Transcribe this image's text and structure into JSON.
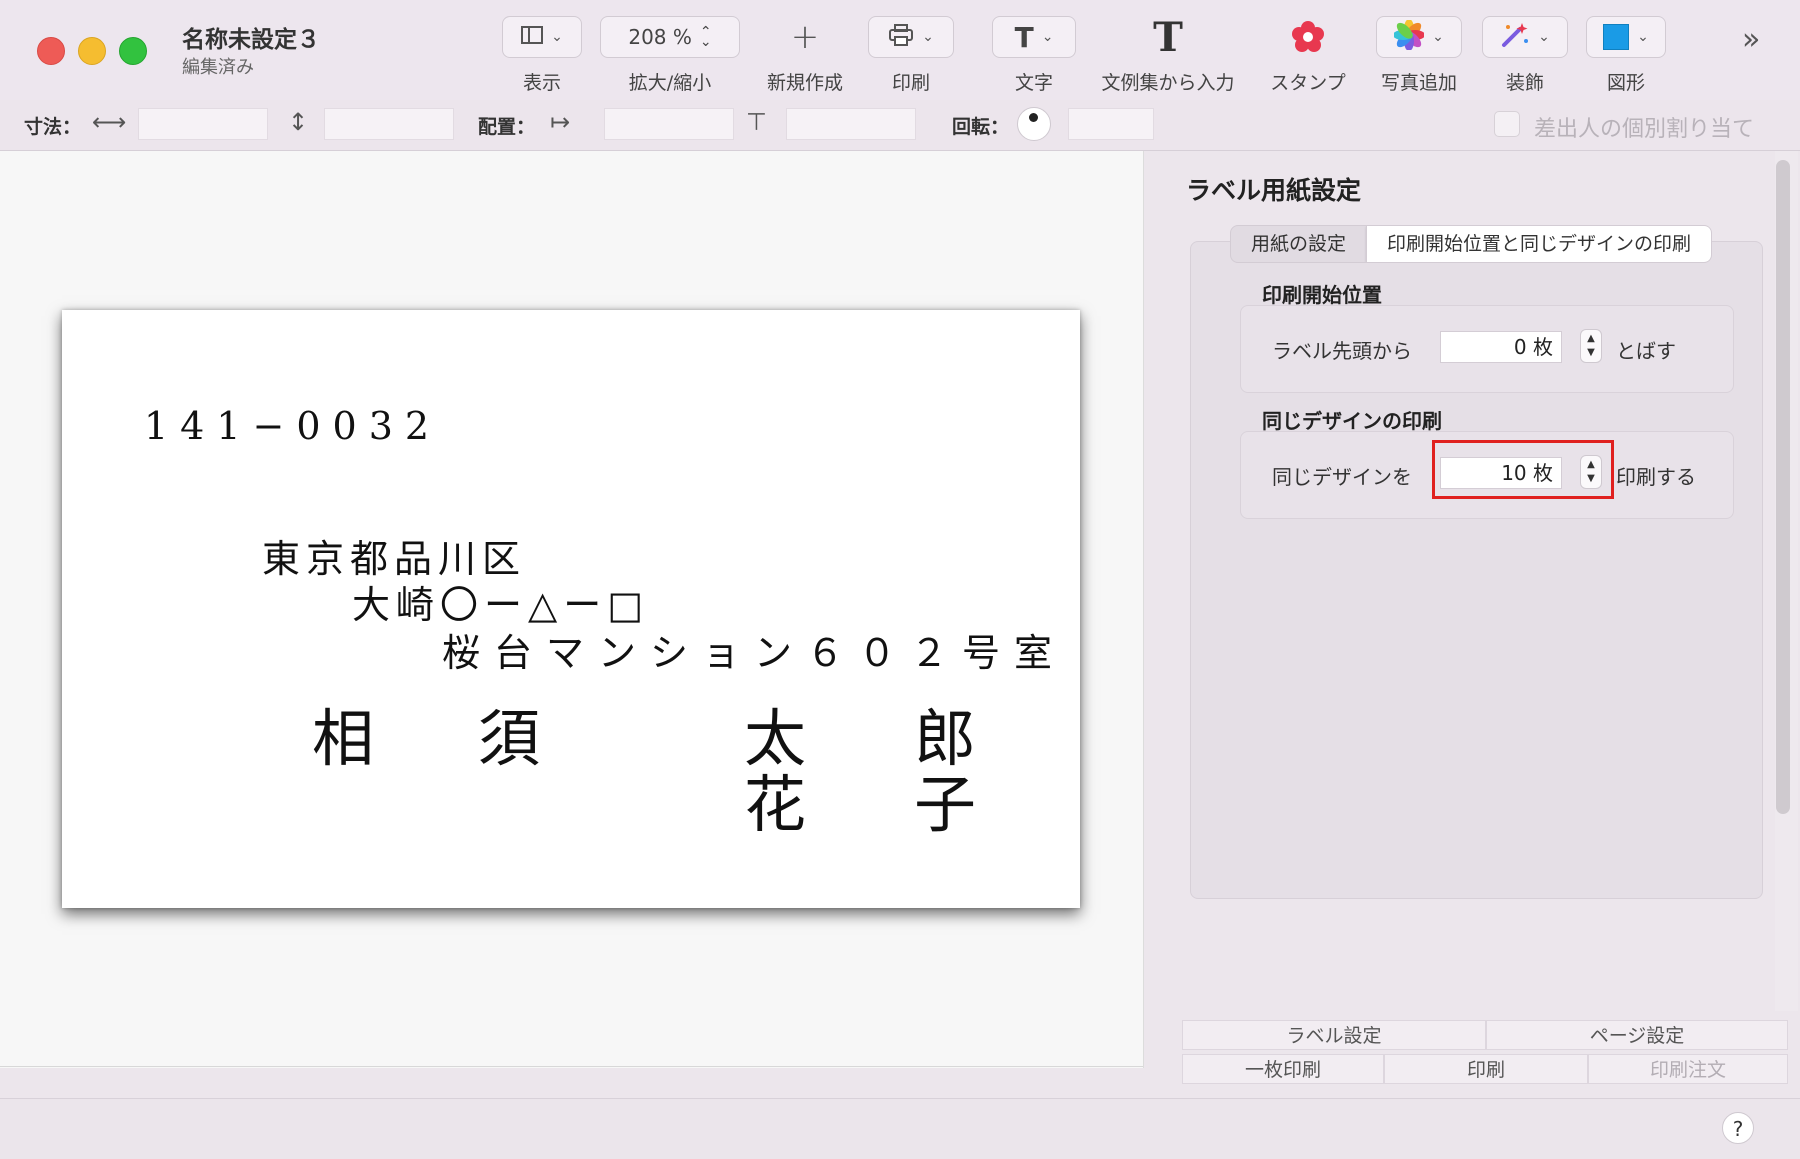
{
  "window": {
    "title": "名称未設定３",
    "subtitle": "編集済み"
  },
  "toolbar": {
    "view_label": "表示",
    "zoom_value": "208 %",
    "zoom_label": "拡大/縮小",
    "new_label": "新規作成",
    "print_label": "印刷",
    "text_label": "文字",
    "phrases_label": "文例集から入力",
    "stamp_label": "スタンプ",
    "photo_label": "写真追加",
    "decoration_label": "装飾",
    "shape_label": "図形",
    "shape_color": "#1a9be6",
    "stamp_color": "#e8384f"
  },
  "propbar": {
    "size_label": "寸法：",
    "align_label": "配置：",
    "rotate_label": "回転：",
    "sender_checkbox_label": "差出人の個別割り当て"
  },
  "label": {
    "postal": "141−0032",
    "address1": "東京都品川区",
    "address2": "大崎〇ー△ー□",
    "address3": "桜台マンション６０２号室",
    "surname1": "相",
    "surname2": "須",
    "given1": [
      "太",
      "郎"
    ],
    "given2": [
      "花",
      "子"
    ]
  },
  "panel": {
    "title": "ラベル用紙設定",
    "tabs": [
      "用紙の設定",
      "印刷開始位置と同じデザインの印刷"
    ],
    "start_group_title": "印刷開始位置",
    "start_row_label": "ラベル先頭から",
    "start_value": "0 枚",
    "start_suffix": "とばす",
    "same_group_title": "同じデザインの印刷",
    "same_row_label": "同じデザインを",
    "same_value": "10 枚",
    "same_suffix": "印刷する"
  },
  "bottom_buttons": {
    "label_settings": "ラベル設定",
    "page_settings": "ページ設定",
    "single_print": "一枚印刷",
    "print": "印刷",
    "print_order": "印刷注文"
  },
  "help": "?"
}
